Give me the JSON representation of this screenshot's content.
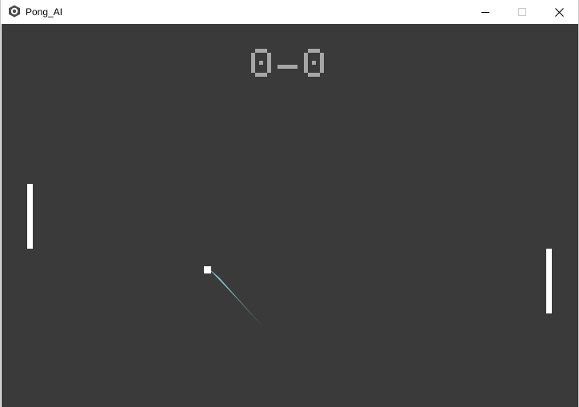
{
  "window": {
    "title": "Pong_AI",
    "icon": "pygame-snake-icon"
  },
  "controls": {
    "minimize_icon": "minimize-icon",
    "maximize_icon": "maximize-icon",
    "close_icon": "close-icon"
  },
  "game": {
    "score_left": "0",
    "score_separator": "-",
    "score_right": "0",
    "left_paddle_center_fraction": 0.5,
    "right_paddle_center_fraction": 0.67,
    "ball_center_y_fraction": 0.64
  },
  "colors": {
    "background": "#3a3a3a",
    "paddle": "#ffffff",
    "ball": "#ffffff",
    "score": "#a6a6a6",
    "trail": "#7cc7c9"
  }
}
